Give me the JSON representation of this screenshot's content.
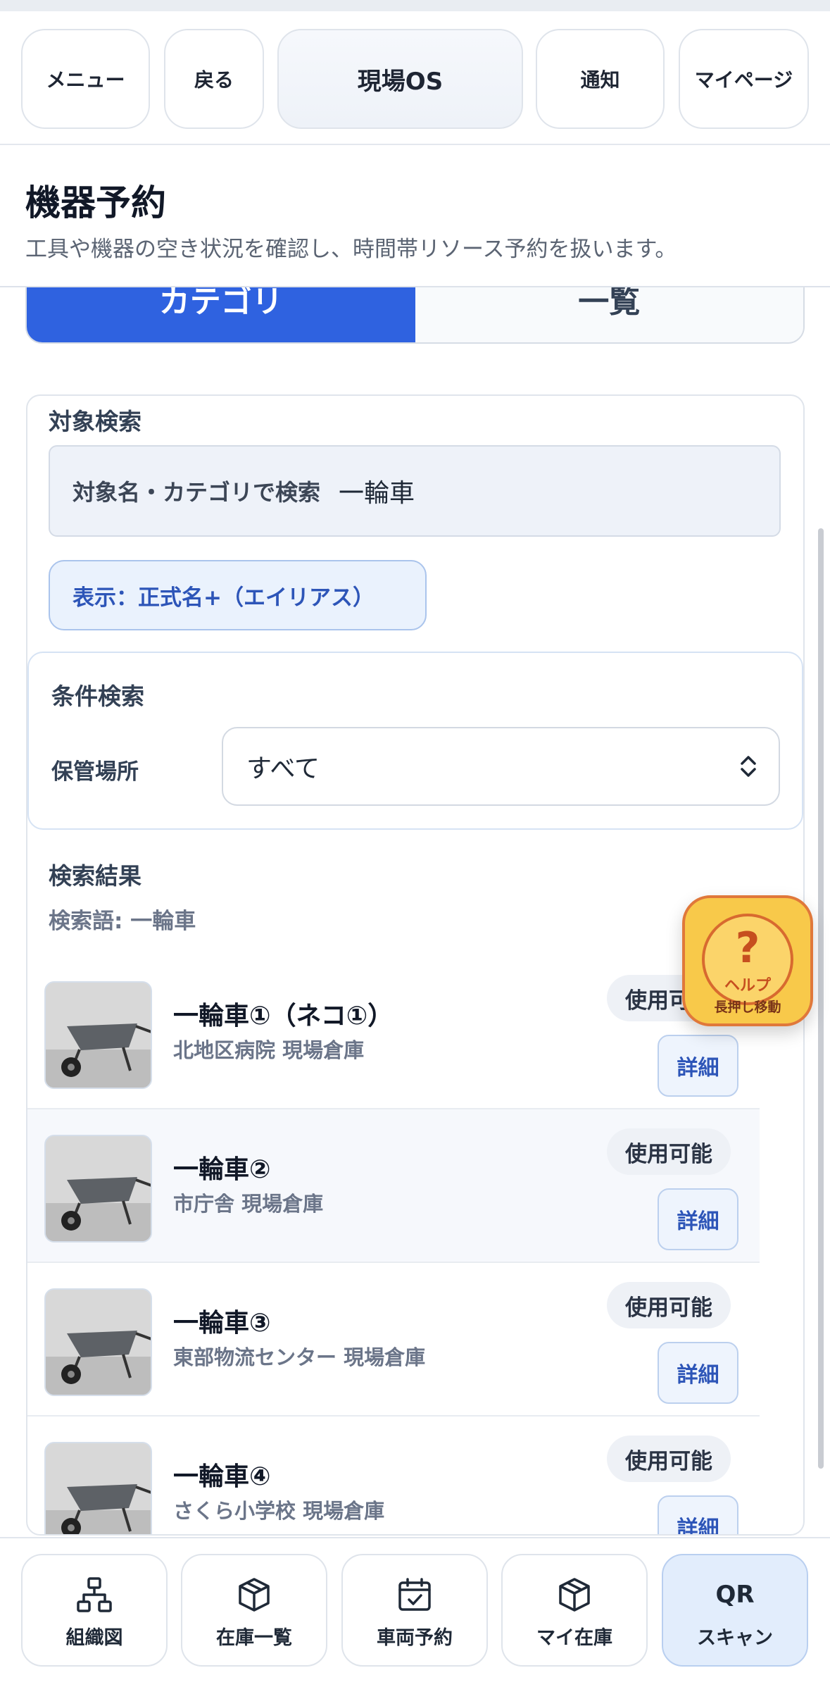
{
  "header": {
    "menu_label": "メニュー",
    "back_label": "戻る",
    "app_title": "現場OS",
    "notice_label": "通知",
    "mypage_label": "マイページ"
  },
  "page": {
    "title": "機器予約",
    "description": "工具や機器の空き状況を確認し、時間帯リソース予約を扱います。"
  },
  "tabs": [
    {
      "label": "カテゴリ",
      "active": true
    },
    {
      "label": "一覧",
      "active": false
    }
  ],
  "search": {
    "section_label": "対象検索",
    "placeholder": "対象名・カテゴリで検索",
    "value": "一輪車",
    "display_toggle": "表示：正式名+（エイリアス）"
  },
  "filter": {
    "section_label": "条件検索",
    "location_label": "保管場所",
    "location_value": "すべて"
  },
  "results": {
    "section_label": "検索結果",
    "term": "検索語: 一輪車",
    "items": [
      {
        "name": "一輪車①（ネコ①）",
        "location": "北地区病院 現場倉庫",
        "status": "使用可能",
        "detail_label": "詳細"
      },
      {
        "name": "一輪車②",
        "location": "市庁舎 現場倉庫",
        "status": "使用可能",
        "detail_label": "詳細"
      },
      {
        "name": "一輪車③",
        "location": "東部物流センター 現場倉庫",
        "status": "使用可能",
        "detail_label": "詳細"
      },
      {
        "name": "一輪車④",
        "location": "さくら小学校 現場倉庫",
        "status": "使用可能",
        "detail_label": "詳細"
      }
    ]
  },
  "help": {
    "symbol": "?",
    "label": "ヘルプ",
    "sub": "長押し移動"
  },
  "bottom_nav": [
    {
      "label": "組織図",
      "icon": "org-chart-icon"
    },
    {
      "label": "在庫一覧",
      "icon": "box-icon"
    },
    {
      "label": "車両予約",
      "icon": "calendar-check-icon"
    },
    {
      "label": "マイ在庫",
      "icon": "box-icon"
    },
    {
      "top": "QR",
      "label": "スキャン",
      "icon": "qr-text"
    }
  ],
  "colors": {
    "accent": "#2f62e0",
    "help_bg": "#f8c94a",
    "help_border": "#e0783a"
  }
}
